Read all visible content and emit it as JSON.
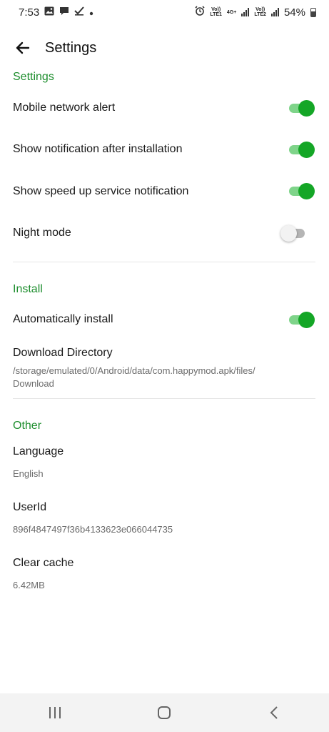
{
  "status_bar": {
    "time": "7:53",
    "battery": "54%",
    "sim1_tag": "Vo))\nLTE1",
    "net_tag": "4G+",
    "sim2_tag": "Vo))\nLTE2",
    "icons": [
      "gallery-icon",
      "chat-icon",
      "check-icon",
      "dot-icon",
      "alarm-icon",
      "signal-icon",
      "battery-icon"
    ]
  },
  "app_bar": {
    "title": "Settings",
    "back_icon": "arrow-left-icon"
  },
  "sections": {
    "settings": {
      "header": "Settings",
      "mobile_network_alert": {
        "label": "Mobile network alert",
        "enabled": true
      },
      "show_notification_after_installation": {
        "label": "Show notification after installation",
        "enabled": true
      },
      "show_speed_up_service_notification": {
        "label": "Show speed up service notification",
        "enabled": true
      },
      "night_mode": {
        "label": "Night mode",
        "enabled": false
      }
    },
    "install": {
      "header": "Install",
      "automatically_install": {
        "label": "Automatically install",
        "enabled": true
      },
      "download_directory": {
        "label": "Download Directory",
        "value": "/storage/emulated/0/Android/data/com.happymod.apk/files/\nDownload"
      }
    },
    "other": {
      "header": "Other",
      "language": {
        "label": "Language",
        "value": "English"
      },
      "user_id": {
        "label": "UserId",
        "value": "896f4847497f36b4133623e066044735"
      },
      "clear_cache": {
        "label": "Clear cache",
        "value": "6.42MB"
      }
    }
  },
  "colors": {
    "accent": "#1e8e2e",
    "toggle_on": "#14a626",
    "toggle_track_on": "#7fd48a"
  },
  "nav_bar": {
    "icons": [
      "recents-icon",
      "home-icon",
      "back-icon"
    ]
  }
}
